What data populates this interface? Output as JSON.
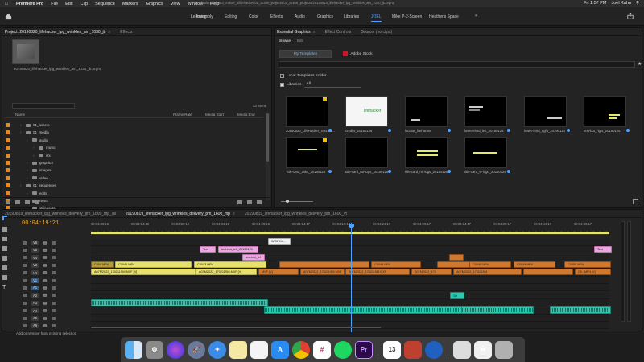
{
  "menubar": {
    "app": "Premiere Pro",
    "items": [
      "File",
      "Edit",
      "Clip",
      "Sequence",
      "Markers",
      "Graphics",
      "View",
      "Window",
      "Help"
    ],
    "path": "/Volumes/2003_Active_3/lifehacker/01_active_projects/01_active_projects/20190820_lifehacker_lpg_wrinkles_am_1030_jb.prproj",
    "time": "Fri 1:57 PM",
    "user": "Joel Kahn"
  },
  "workspaces": {
    "tabs": [
      "Learning",
      "Assembly",
      "Editing",
      "Color",
      "Effects",
      "Audio",
      "Graphics",
      "Libraries",
      "JOEL",
      "Mike P-2-Screen",
      "Heather's Space"
    ],
    "active": "JOEL",
    "more": "»"
  },
  "project": {
    "tabs": [
      "Project: 20190820_lifehacker_lpg_wrinkles_am_1030_jb",
      "Effects"
    ],
    "file": "20190820_lifehacker_lpg_wrinkles_am_1030_jb.prproj",
    "items_count": "13 Items",
    "columns": {
      "name": "Name",
      "frame_rate": "Frame Rate",
      "media_start": "Media Start",
      "media_end": "Media End"
    },
    "rows": [
      {
        "label": "01_assets",
        "indent": 1,
        "color": "#e88a1a"
      },
      {
        "label": "01_media",
        "indent": 1,
        "color": "#e88a1a"
      },
      {
        "label": "audio",
        "indent": 2,
        "color": "#e88a1a"
      },
      {
        "label": "music",
        "indent": 3,
        "color": "#e88a1a"
      },
      {
        "label": "sfx",
        "indent": 3,
        "color": "#e88a1a"
      },
      {
        "label": "graphics",
        "indent": 2,
        "color": "#e88a1a"
      },
      {
        "label": "images",
        "indent": 2,
        "color": "#e88a1a"
      },
      {
        "label": "video",
        "indent": 2,
        "color": "#e88a1a"
      },
      {
        "label": "01_sequences",
        "indent": 1,
        "color": "#e88a1a"
      },
      {
        "label": "edits",
        "indent": 2,
        "color": "#e88a1a"
      },
      {
        "label": "nests",
        "indent": 2,
        "color": "#e88a1a"
      },
      {
        "label": "stringouts",
        "indent": 2,
        "color": "#e88a1a"
      },
      {
        "label": "Motion Graphics Template Media",
        "indent": 1,
        "color": "#e88a1a"
      }
    ]
  },
  "essential_graphics": {
    "tabs": [
      "Essential Graphics",
      "Effect Controls",
      "Source: (no clips)"
    ],
    "sub_tabs": [
      "Browse",
      "Edit"
    ],
    "my_templates": "My Templates",
    "adobe_stock": "Adobe Stock",
    "local_templates": "Local Templates Folder",
    "libraries": "Libraries",
    "libraries_value": "All",
    "templates": [
      {
        "label": "20190820_LifeHacker_Text.ccl..."
      },
      {
        "label": "credits_20190128"
      },
      {
        "label": "locator_lifehacker"
      },
      {
        "label": "lower-third_left_20190125"
      },
      {
        "label": "lower-third_right_20190125"
      },
      {
        "label": "text-bot_right_20190125"
      },
      {
        "label": "Title-card_asks_20190128"
      },
      {
        "label": "title-card_no-logo_20190128"
      },
      {
        "label": "title-card_no-logo_20190128"
      },
      {
        "label": "title-card_w-logo_20190128"
      }
    ]
  },
  "timeline": {
    "tabs": [
      "20190819_lifehacker_lpg_wrinkles_delivery_pm_1600_mp_all",
      "20190819_lifehacker_lpg_wrinkles_delivery_pm_1600_mp",
      "20190819_lifehacker_lpg_wrinkles_delivery_pm_1600_vt"
    ],
    "active_tab": 1,
    "timecode": "00:04:19:21",
    "ruler": [
      "00:03:49:18",
      "00:03:54:18",
      "00:03:59:18",
      "00:04:04:18",
      "00:04:09:18",
      "00:04:14:17",
      "00:04:19:17",
      "00:04:24:17",
      "00:04:29:17",
      "00:04:34:17",
      "00:04:39:17",
      "00:04:44:17",
      "00:04:49:17"
    ],
    "video_tracks": [
      "V6",
      "V5",
      "V4",
      "V3",
      "V2",
      "V1"
    ],
    "audio_tracks": [
      "A1",
      "A2",
      "A3",
      "A4",
      "A5",
      "A6"
    ],
    "clip_labels": {
      "text": "Text",
      "text_bot_left": "text-bot_left_20190120",
      "wrinkle": "WRINKL...",
      "text_bot": "text-bot_lef",
      "c004": "C004.MP4",
      "c0041": "C0041.MP4",
      "c0043": "C0043.MP4",
      "c0045": "C0045.MP4",
      "c0046": "C0046.MP4",
      "c0049": "C0049.MP4",
      "a07": "A07M2022_170211SM.MXF [V]",
      "a07b": "A07M2022_170211SM.MXF",
      "a07c": "A07M2022_1702115M.MXF",
      "a07d": "A07M2022_170",
      "a07e": "A07M2022_1702115M",
      "mxf": "MXF [V]",
      "c0mp4": "C0...MP4 [V]",
      "c0050": "C0050.MP4",
      "ge": "Ge"
    }
  },
  "status_bar": "Add or remove from existing selection",
  "dock": {
    "apps": [
      "Finder",
      "System Preferences",
      "Siri",
      "Launchpad",
      "Safari",
      "Notes",
      "Reminders",
      "App Store",
      "Chrome",
      "Slack",
      "Spotify",
      "Premiere Pro",
      "Calendar",
      "Photo Booth",
      "Camo",
      "Preview",
      "Mail",
      "Trash"
    ],
    "calendar_day": "13",
    "premiere_letters": "Pr"
  }
}
